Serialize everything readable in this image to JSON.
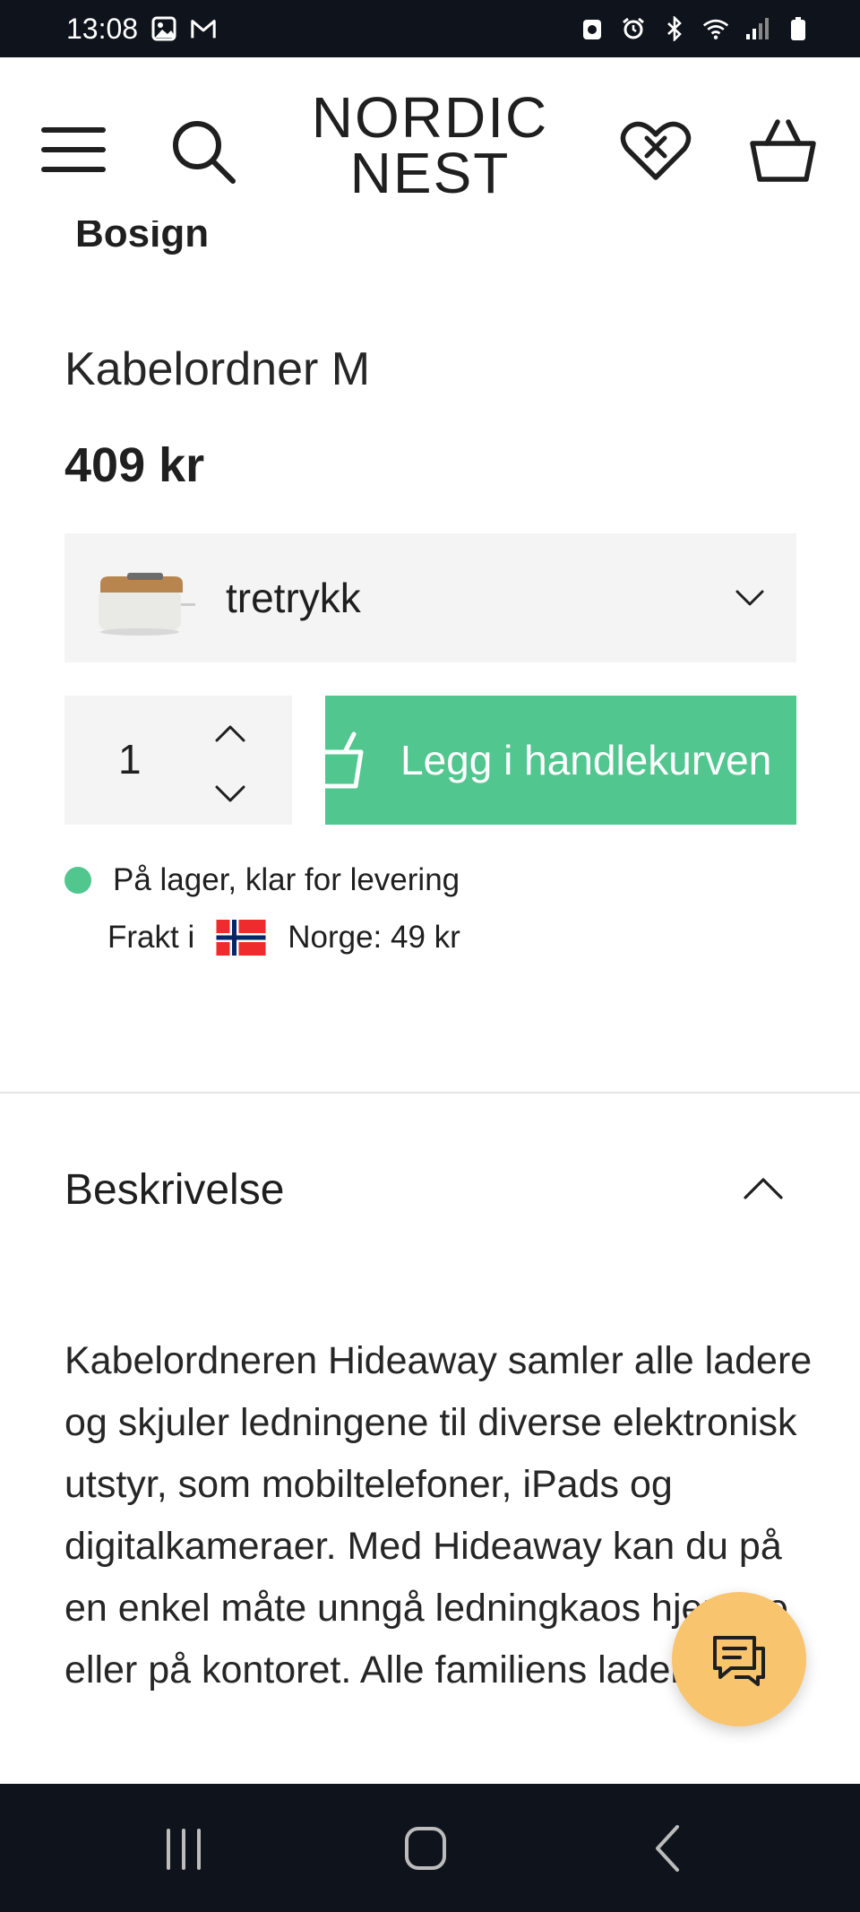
{
  "status_bar": {
    "time": "13:08"
  },
  "header": {
    "logo_line1": "NORDIC",
    "logo_line2": "NEST"
  },
  "product": {
    "brand_peek": "Bosign",
    "title": "Kabelordner M",
    "price": "409 kr",
    "variant": {
      "selected": "tretrykk"
    },
    "quantity": "1",
    "add_to_cart_label": "Legg i handlekurven",
    "stock_status": "På lager, klar for levering",
    "shipping_prefix": "Frakt i",
    "shipping_country_price": "Norge: 49 kr"
  },
  "description_section": {
    "title": "Beskrivelse",
    "text": "Kabelordneren Hideaway samler alle ladere og skjuler ledningene til diverse elektronisk utstyr, som mobiltelefoner, iPads og digitalkameraer. Med Hideaway kan du på en enkel måte unngå ledningkaos hjemme eller på kontoret. Alle familiens lader"
  },
  "colors": {
    "accent_green": "#52c68f",
    "chat_yellow": "#f8c46e",
    "system_bar": "#0f141c",
    "panel_gray": "#f4f4f4"
  },
  "icons": {
    "menu": "hamburger-icon",
    "search": "search-icon",
    "wishlist": "heart-icon",
    "cart": "basket-icon",
    "chat": "chat-icon"
  }
}
